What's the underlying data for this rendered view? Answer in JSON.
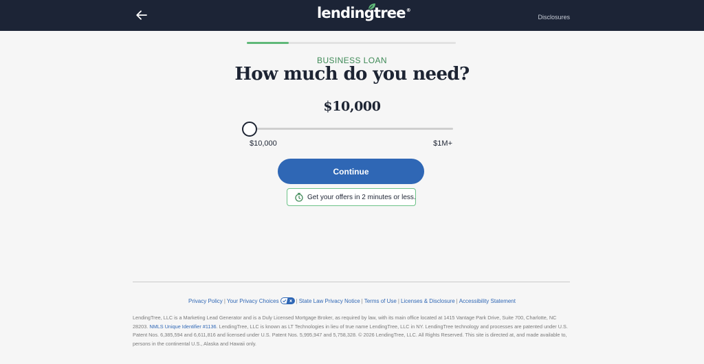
{
  "header": {
    "logo_text": "lendingtree",
    "logo_reg": "®",
    "disclosures_label": "Disclosures"
  },
  "progress": {
    "fraction": 0.2
  },
  "form": {
    "eyebrow": "BUSINESS LOAN",
    "headline": "How much do you need?",
    "amount_display": "$10,000",
    "slider": {
      "min_label": "$10,000",
      "max_label": "$1M+",
      "value_fraction": 0.0
    },
    "continue_label": "Continue",
    "badge_text": "Get your offers in 2 minutes or less."
  },
  "footer": {
    "links": [
      {
        "label": "Privacy Policy"
      },
      {
        "label": "Your Privacy Choices"
      },
      {
        "label": "State Law Privacy Notice"
      },
      {
        "label": "Terms of Use"
      },
      {
        "label": "Licenses & Disclosure"
      },
      {
        "label": "Accessibility Statement"
      }
    ],
    "separator": "|",
    "legal_part1": "LendingTree, LLC is a Marketing Lead Generator and is a Duly Licensed Mortgage Broker, as required by law, with its main office located at 1415 Vantage Park Drive, Suite 700, Charlotte, NC 28203. ",
    "legal_link": "NMLS Unique Identifier #1136",
    "legal_part2": ". LendingTree, LLC is known as LT Technologies in lieu of true name LendingTree, LLC in NY. LendingTree technology and processes are patented under U.S. Patent Nos. 6,385,594 and 6,611,816 and licensed under U.S. Patent Nos. 5,995,947 and 5,758,328. © 2026 LendingTree, LLC. All Rights Reserved. This site is directed at, and made available to, persons in the continental U.S., Alaska and Hawaii only."
  },
  "colors": {
    "header_bg": "#1c2436",
    "accent_green": "#5fb878",
    "primary_blue": "#2f67b5",
    "text_dark": "#1d2433"
  },
  "icons": {
    "back": "arrow-left-icon",
    "logo_leaf": "leaf-icon",
    "timer": "stopwatch-icon",
    "privacy_choices": "privacy-choices-toggle-icon"
  }
}
